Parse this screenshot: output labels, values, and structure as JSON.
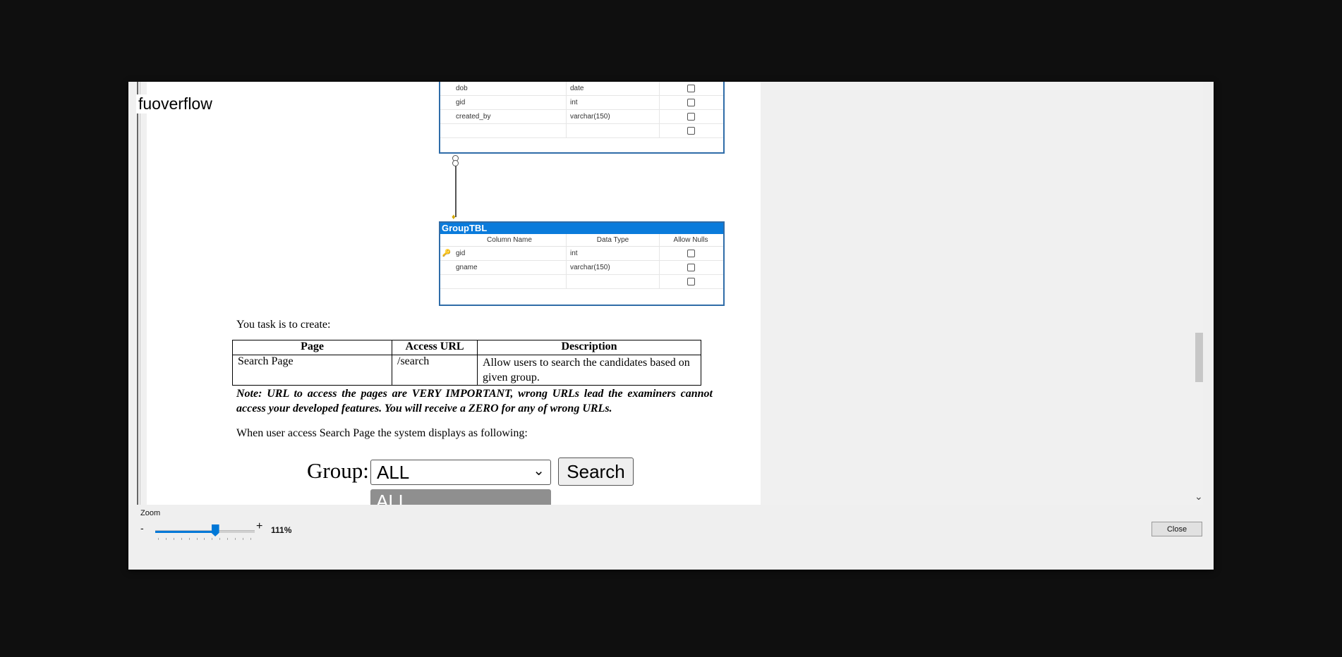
{
  "app": {
    "title": "fuoverflow"
  },
  "er": {
    "upper_table": {
      "rows": [
        {
          "name": "dob",
          "type": "date"
        },
        {
          "name": "gid",
          "type": "int"
        },
        {
          "name": "created_by",
          "type": "varchar(150)"
        },
        {
          "name": "",
          "type": ""
        }
      ]
    },
    "group_table": {
      "title": "GroupTBL",
      "col_name": "Column Name",
      "col_type": "Data Type",
      "col_null": "Allow Nulls",
      "rows": [
        {
          "key": "🔑",
          "name": "gid",
          "type": "int"
        },
        {
          "key": "",
          "name": "gname",
          "type": "varchar(150)"
        },
        {
          "key": "",
          "name": "",
          "type": ""
        }
      ]
    }
  },
  "doc": {
    "task_intro": "You task is to create:",
    "task_table": {
      "headers": [
        "Page",
        "Access URL",
        "Description"
      ],
      "rows": [
        {
          "page": "Search Page",
          "url": "/search",
          "desc": "Allow users to search the candidates based on given group."
        }
      ]
    },
    "note": "Note: URL to access the pages are VERY IMPORTANT, wrong URLs lead the examiners cannot access your developed features. You will receive a ZERO for any of wrong URLs.",
    "display_intro": "When user access Search Page the system displays as following:",
    "group_label": "Group:",
    "group_selected": "ALL",
    "search_button": "Search",
    "dropdown_option": "ALL"
  },
  "controls": {
    "zoom_label": "Zoom",
    "zoom_minus": "-",
    "zoom_plus": "+",
    "zoom_value": "111%",
    "zoom_level_fraction": 0.6,
    "close_label": "Close",
    "accent_color": "#0078d7"
  }
}
